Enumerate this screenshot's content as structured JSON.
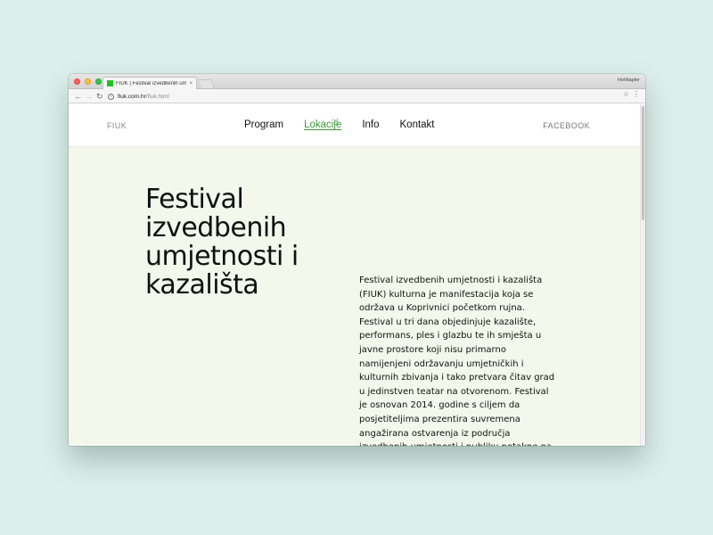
{
  "browser": {
    "tab_title": "FIUK | Festival izvedbenih umjetnosti i kazališta",
    "tab_close": "×",
    "profile": "Hohltapler",
    "url_host": "fiuk.com.hr",
    "url_path": "/fiuk.html",
    "icons": {
      "back": "←",
      "forward": "→",
      "reload": "↻",
      "info": "i",
      "star": "☆",
      "menu": "⋮"
    },
    "colors": {
      "favicon": "#1ec41e"
    }
  },
  "site": {
    "brand": "FIUK",
    "nav": [
      {
        "label": "Program"
      },
      {
        "label": "Lokacije",
        "active": true
      },
      {
        "label": "Info"
      },
      {
        "label": "Kontakt"
      }
    ],
    "facebook": "FACEBOOK",
    "hero": {
      "title": "Festival izvedbenih umjetnosti i kazališta",
      "body": "Festival izvedbenih umjetnosti i kazališta (FIUK) kulturna je manifestacija koja se održava u Koprivnici početkom rujna. Festival u tri dana objedinjuje kazalište, performans, ples i glazbu te ih smješta u javne prostore koji nisu primarno namijenjeni održavanju umjetničkih i kulturnih zbivanja i tako pretvara čitav grad u jedinstven teatar na otvorenom. Festival je osnovan 2014. godine s ciljem da posjetiteljima prezentira suvremena angažirana ostvarenja iz područja izvedbenih umjetnosti i publiku potakne na interakciju s gradskim prostorima, demistifikaciju kulture"
    },
    "colors": {
      "accent": "#3a9a3a",
      "hero_background": "#f4f8ec",
      "page_background": "#dcefea"
    }
  }
}
